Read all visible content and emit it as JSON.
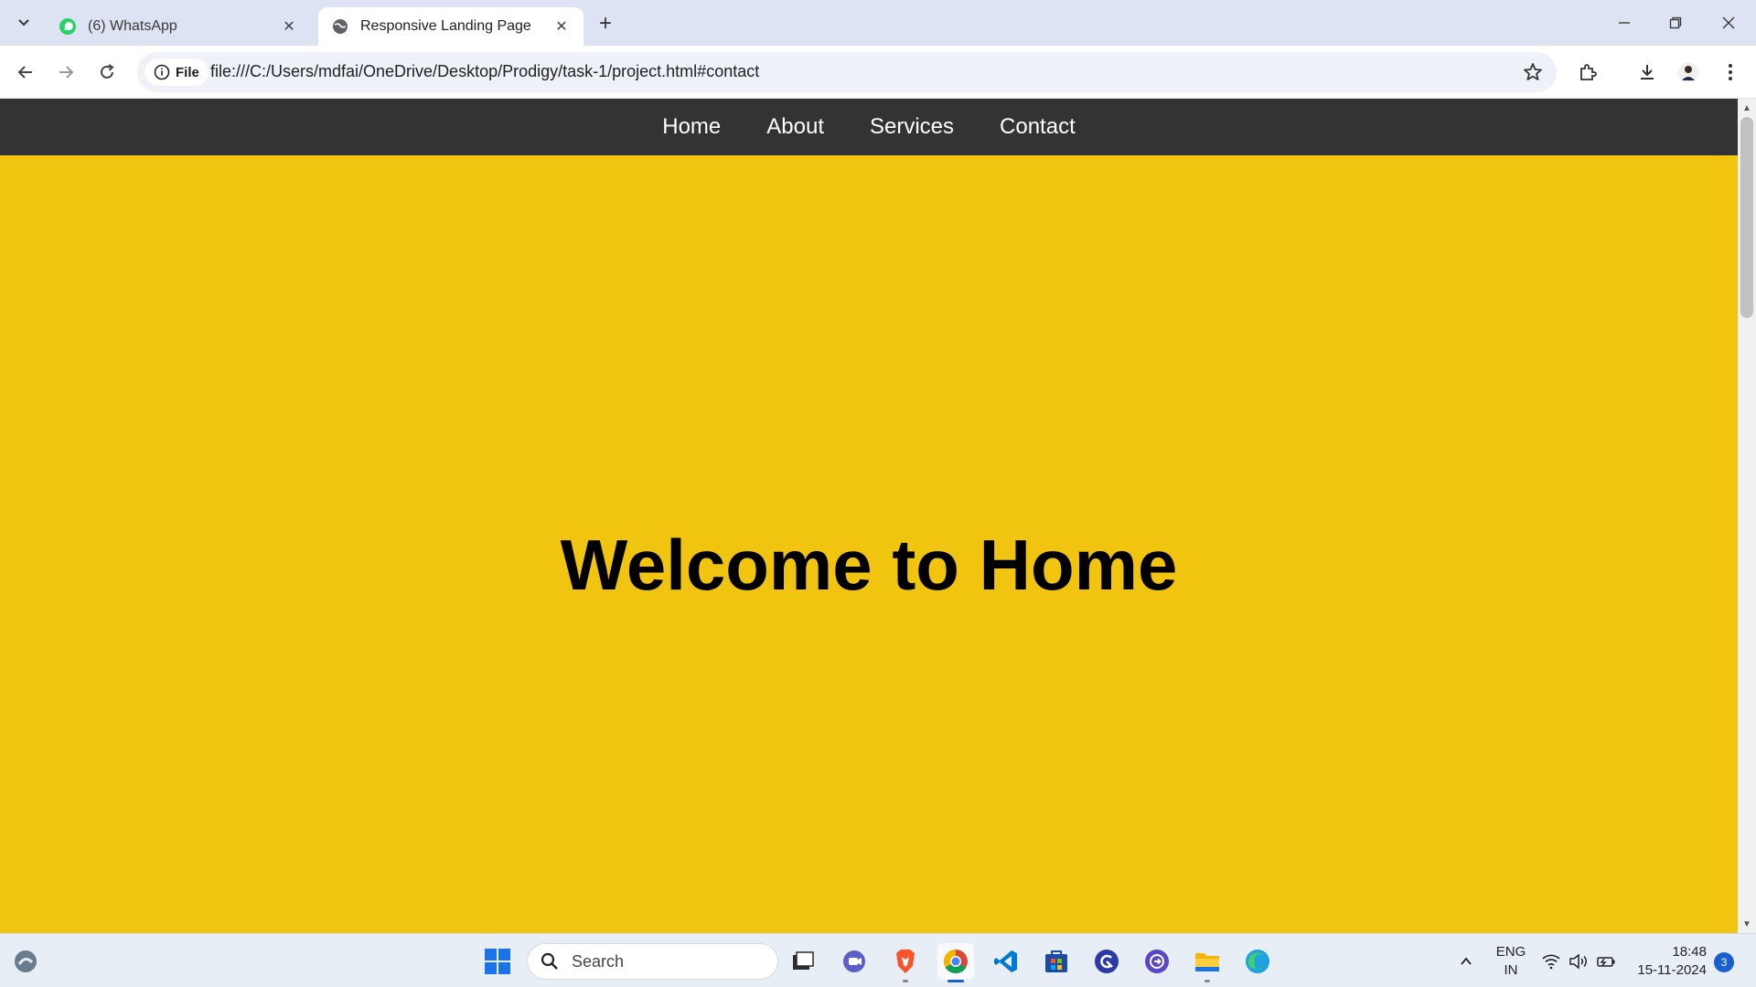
{
  "browser": {
    "tabs": [
      {
        "title": "(6) WhatsApp",
        "favicon": "whatsapp-icon",
        "active": false
      },
      {
        "title": "Responsive Landing Page",
        "favicon": "globe-icon",
        "active": true
      }
    ],
    "site_chip_label": "File",
    "url": "file:///C:/Users/mdfai/OneDrive/Desktop/Prodigy/task-1/project.html#contact"
  },
  "page": {
    "nav_items": [
      "Home",
      "About",
      "Services",
      "Contact"
    ],
    "hero_title": "Welcome to Home",
    "colors": {
      "hero_bg": "#f1c40f",
      "nav_bg": "#333333"
    }
  },
  "taskbar": {
    "search_placeholder": "Search",
    "language": {
      "line1": "ENG",
      "line2": "IN"
    },
    "time": "18:48",
    "date": "15-11-2024",
    "notification_count": "3"
  }
}
